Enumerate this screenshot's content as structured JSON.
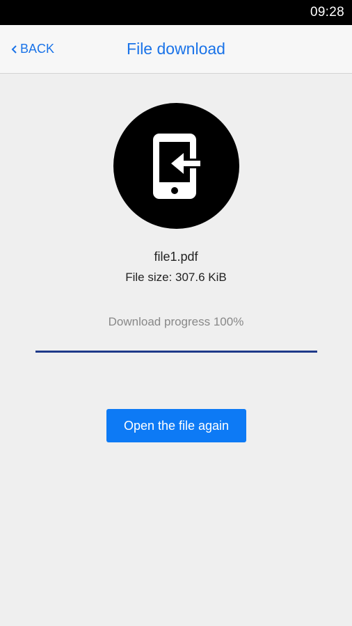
{
  "status_bar": {
    "time": "09:28"
  },
  "nav": {
    "back_label": "BACK",
    "title": "File download"
  },
  "file": {
    "name": "file1.pdf",
    "size_text": "File size: 307.6 KiB"
  },
  "download": {
    "progress_text": "Download progress 100%",
    "progress": 1.0
  },
  "actions": {
    "open_again_label": "Open the file again"
  },
  "icons": {
    "back": "chevron-left-icon",
    "hero": "phone-receive-icon"
  },
  "colors": {
    "accent": "#1a73e8",
    "button": "#0d7af5",
    "progress": "#1f3a8a"
  }
}
